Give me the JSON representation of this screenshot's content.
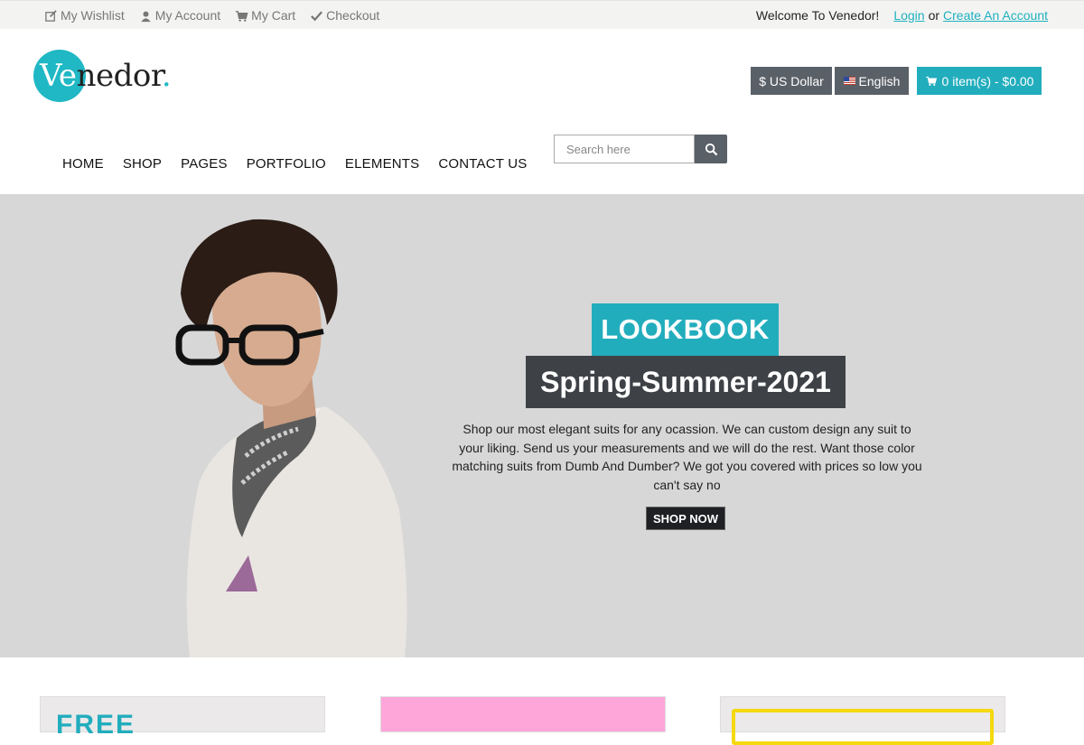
{
  "topbar": {
    "links": [
      {
        "label": "My Wishlist",
        "icon": "edit-icon"
      },
      {
        "label": "My Account",
        "icon": "user-icon"
      },
      {
        "label": "My Cart",
        "icon": "cart-icon"
      },
      {
        "label": "Checkout",
        "icon": "check-icon"
      }
    ],
    "welcome": "Welcome To Venedor!",
    "login": "Login",
    "or": "or",
    "create_account": "Create An Account"
  },
  "logo": {
    "ve": "Ve",
    "rest": "nedor",
    "dot": "."
  },
  "header": {
    "currency": "$ US Dollar",
    "language": "English",
    "cart": "0 item(s) - $0.00"
  },
  "nav": [
    "HOME",
    "SHOP",
    "PAGES",
    "PORTFOLIO",
    "ELEMENTS",
    "CONTACT US"
  ],
  "search": {
    "placeholder": "Search here"
  },
  "hero": {
    "tag": "LOOKBOOK",
    "title": "Spring-Summer-2021",
    "description": "Shop our most elegant suits for any ocassion. We can custom design any suit to your liking. Send us your measurements and we will do the rest. Want those color matching suits from Dumb And Dumber? We got you covered with prices so low you can't say no",
    "cta": "SHOP NOW"
  },
  "promo": {
    "card1_text": "FREE"
  },
  "colors": {
    "accent": "#22adbd",
    "dark_button": "#5a6068",
    "hero_bg": "#d7d7d7",
    "pink": "#fea6da",
    "yellow": "#f5d80f"
  }
}
